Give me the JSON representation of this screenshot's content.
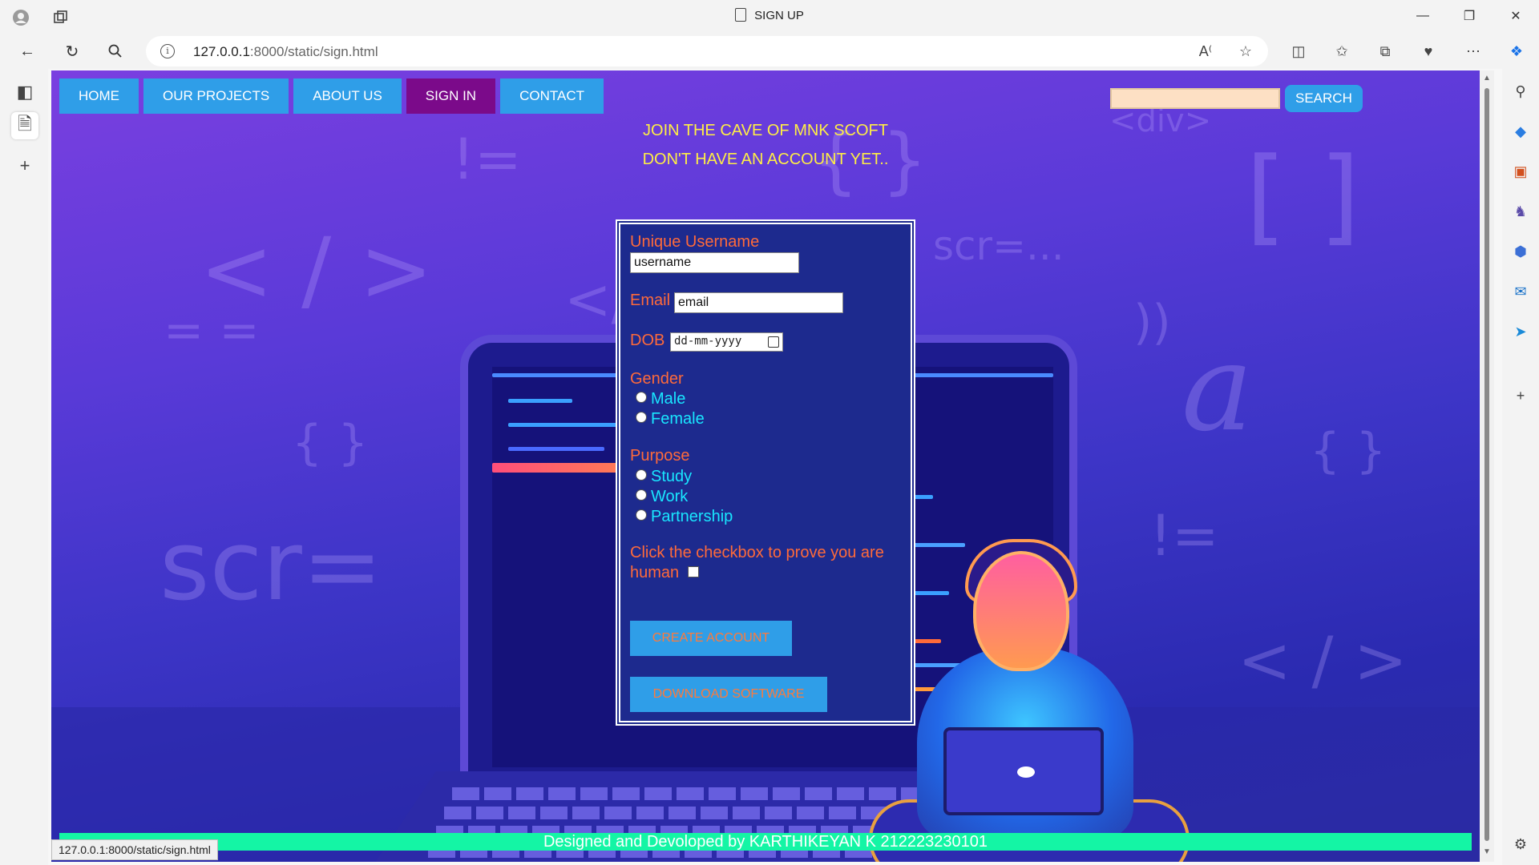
{
  "window": {
    "title": "SIGN UP"
  },
  "address_bar": {
    "url_host": "127.0.0.1",
    "url_rest": ":8000/static/sign.html"
  },
  "nav": {
    "items": [
      {
        "label": "HOME",
        "active": false
      },
      {
        "label": "OUR PROJECTS",
        "active": false
      },
      {
        "label": "ABOUT US",
        "active": false
      },
      {
        "label": "SIGN IN",
        "active": true
      },
      {
        "label": "CONTACT",
        "active": false
      }
    ],
    "search_button": "SEARCH",
    "search_value": ""
  },
  "headings": {
    "line1": "JOIN THE CAVE OF MNK SCOFT",
    "line2": "DON'T HAVE AN ACCOUNT YET.."
  },
  "form": {
    "username_label": "Unique Username",
    "username_value": "username",
    "email_label": "Email",
    "email_value": "email",
    "dob_label": "DOB",
    "dob_placeholder": "dd-mm-yyyy",
    "gender_label": "Gender",
    "gender_options": [
      "Male",
      "Female"
    ],
    "purpose_label": "Purpose",
    "purpose_options": [
      "Study",
      "Work",
      "Partnership"
    ],
    "captcha_label_line1": "Click the checkbox to prove you are",
    "captcha_label_line2": "human",
    "create_button": "CREATE ACCOUNT",
    "download_button": "DOWNLOAD SOFTWARE"
  },
  "background_glyphs": [
    "</div>",
    "{ }",
    "!=",
    "< / >",
    "scr=...",
    "<div>",
    "[ ]",
    "))",
    "= =",
    "a",
    "scr=",
    "< / >",
    "!="
  ],
  "footer": {
    "text": "Designed and Devoloped by KARTHIKEYAN K 212223230101"
  },
  "status_bar": {
    "url": "127.0.0.1:8000/static/sign.html"
  },
  "colors": {
    "nav_button": "#2f9ee8",
    "nav_active": "#7b0a8a",
    "heading": "#ffee44",
    "form_label": "#ff6a3a",
    "radio_label": "#19e6ff",
    "footer": "#14f5a5"
  }
}
